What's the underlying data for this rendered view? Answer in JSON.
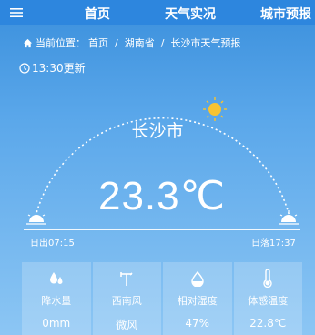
{
  "nav": {
    "menu_icon": "hamburger-menu-icon",
    "items": [
      "首页",
      "天气实况",
      "城市预报"
    ]
  },
  "breadcrumb": {
    "prefix": "当前位置：",
    "items": [
      "首页",
      "湖南省",
      "长沙市天气预报"
    ],
    "separator": "/"
  },
  "update_time": "13:30更新",
  "city": "长沙市",
  "temperature": "23.3℃",
  "sun": {
    "sunrise": "日出07:15",
    "sunset": "日落17:37",
    "sun_color": "#f7c331"
  },
  "cards": [
    {
      "icon": "raindrops-icon",
      "label": "降水量",
      "value": "0mm"
    },
    {
      "icon": "wind-vane-icon",
      "label": "西南风",
      "value": "微风"
    },
    {
      "icon": "humidity-drop-icon",
      "label": "相对湿度",
      "value": "47%"
    },
    {
      "icon": "thermometer-icon",
      "label": "体感温度",
      "value": "22.8℃"
    }
  ]
}
